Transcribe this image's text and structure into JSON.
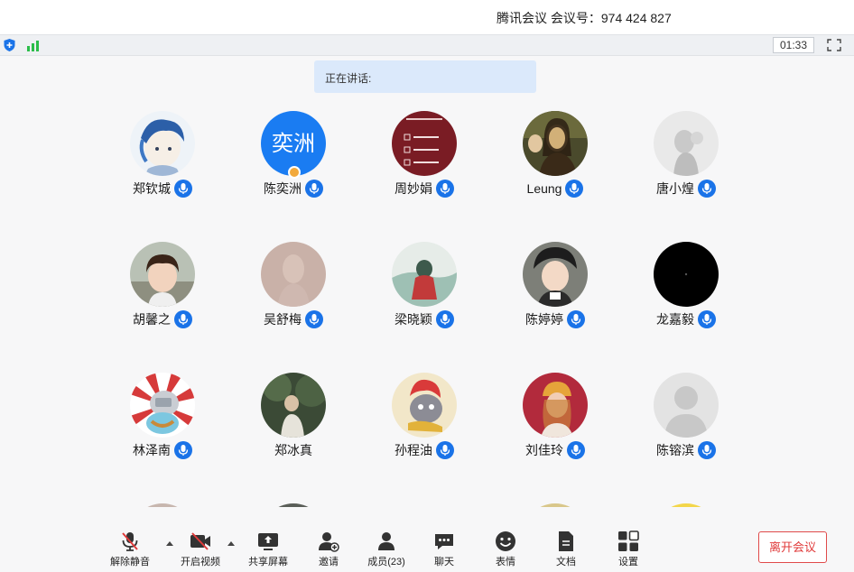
{
  "titlebar": {
    "title": "腾讯会议 会议号：974 424 827"
  },
  "statusbar": {
    "timer": "01:33"
  },
  "speaking": {
    "label": "正在讲话:"
  },
  "host_avatar_text": "奕洲",
  "members": [
    {
      "name": "郑钦城",
      "mic": true
    },
    {
      "name": "陈奕洲",
      "mic": true
    },
    {
      "name": "周妙娟",
      "mic": true
    },
    {
      "name": "Leung",
      "mic": true
    },
    {
      "name": "唐小煌",
      "mic": true
    },
    {
      "name": "胡馨之",
      "mic": true
    },
    {
      "name": "吴舒梅",
      "mic": true
    },
    {
      "name": "梁晓颖",
      "mic": true
    },
    {
      "name": "陈婷婷",
      "mic": true
    },
    {
      "name": "龙嘉毅",
      "mic": true
    },
    {
      "name": "林泽南",
      "mic": true
    },
    {
      "name": "郑冰真",
      "mic": false
    },
    {
      "name": "孙程油",
      "mic": true
    },
    {
      "name": "刘佳玲",
      "mic": true
    },
    {
      "name": "陈镕滨",
      "mic": true
    }
  ],
  "toolbar": {
    "unmute": "解除静音",
    "start_video": "开启视频",
    "share_screen": "共享屏幕",
    "invite": "邀请",
    "members": "成员(23)",
    "chat": "聊天",
    "reactions": "表情",
    "docs": "文档",
    "settings": "设置",
    "leave": "离开会议"
  },
  "colors": {
    "accent": "#1a73e8",
    "leave": "#e03a3a",
    "speaking_bg": "#dbe9fb"
  }
}
